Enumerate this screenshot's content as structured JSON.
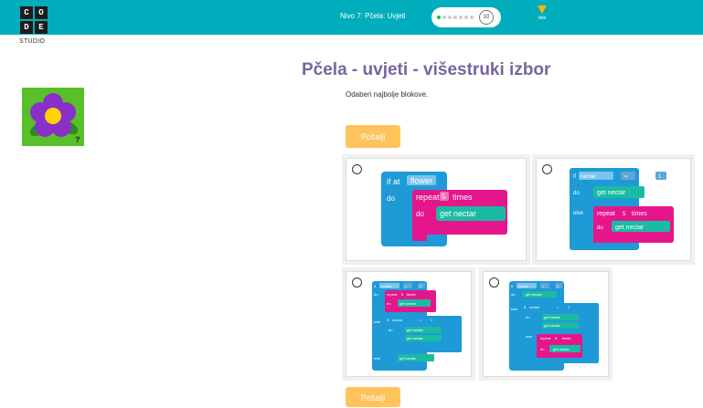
{
  "header": {
    "logo_letters": [
      "C",
      "O",
      "D",
      "E"
    ],
    "logo_caption": "STUDIO",
    "level_title": "Nivo 7: Pčela: Uvjeti",
    "progress": {
      "total_steps": 7,
      "completed_steps": 1,
      "current_step_label": "10"
    },
    "more_label": "više",
    "accent_color": "#00adbc"
  },
  "sidebar": {
    "image_icon": "flower-hint-icon"
  },
  "main": {
    "title": "Pčela - uvjeti - višestruki izbor",
    "instructions": "Odaberi najbolje blokove.",
    "submit_label_top": "Pošalji",
    "submit_label_bottom": "Pošalji",
    "choices": [
      {
        "selected": false,
        "lines": [
          "if at",
          "flower",
          "do",
          "repeat",
          "5",
          "times",
          "do",
          "get nectar"
        ]
      },
      {
        "selected": false,
        "lines": [
          "if",
          "nectar",
          "=",
          "1",
          "do",
          "get nectar",
          "else",
          "repeat",
          "5",
          "times",
          "do",
          "get nectar"
        ]
      },
      {
        "selected": false,
        "lines": [
          "if",
          "nectar",
          "=",
          "0",
          "do",
          "repeat",
          "5",
          "times",
          "do",
          "get nectar",
          "else",
          "if",
          "nectar",
          "=",
          "1",
          "do",
          "get nectar",
          "get nectar",
          "else",
          "get nectar"
        ]
      },
      {
        "selected": false,
        "lines": [
          "if",
          "nectar",
          "=",
          "0",
          "do",
          "get nectar",
          "else",
          "if",
          "nectar",
          "=",
          "1",
          "do",
          "get nectar",
          "get nectar",
          "else",
          "repeat",
          "5",
          "times",
          "do",
          "get nectar"
        ]
      }
    ]
  },
  "colors": {
    "title": "#7665a0",
    "submit": "#ffc35c",
    "logic_block": "#1e9ad6",
    "loop_block": "#e5158c",
    "action_block": "#1bbba3"
  }
}
